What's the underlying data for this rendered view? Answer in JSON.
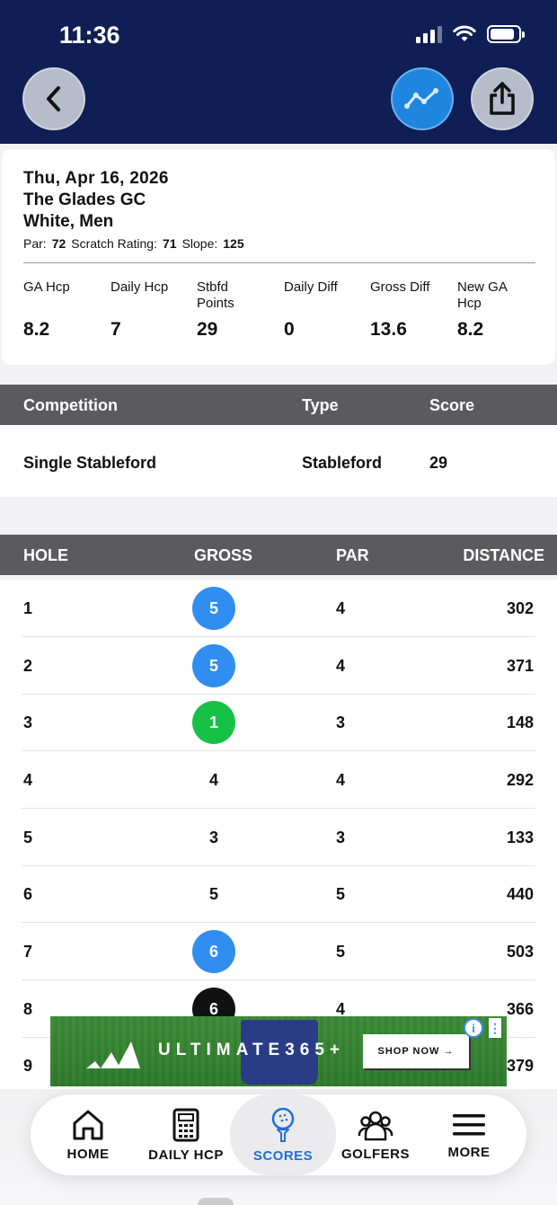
{
  "status_bar": {
    "time": "11:36"
  },
  "header": {
    "back_icon": "chevron-left-icon",
    "chart_icon": "trend-line-icon",
    "share_icon": "share-icon"
  },
  "round": {
    "date": "Thu, Apr 16, 2026",
    "course": "The Glades GC",
    "tee": "White, Men",
    "par_label": "Par:",
    "par": "72",
    "scratch_label": "Scratch Rating:",
    "scratch": "71",
    "slope_label": "Slope:",
    "slope": "125"
  },
  "stats": [
    {
      "label": "GA Hcp",
      "value": "8.2"
    },
    {
      "label": "Daily Hcp",
      "value": "7"
    },
    {
      "label": "Stbfd Points",
      "value": "29"
    },
    {
      "label": "Daily Diff",
      "value": "0"
    },
    {
      "label": "Gross Diff",
      "value": "13.6"
    },
    {
      "label": "New GA Hcp",
      "value": "8.2"
    }
  ],
  "competition": {
    "headers": {
      "competition": "Competition",
      "type": "Type",
      "score": "Score"
    },
    "row": {
      "competition": "Single Stableford",
      "type": "Stableford",
      "score": "29"
    }
  },
  "holes_table": {
    "headers": {
      "hole": "HOLE",
      "gross": "GROSS",
      "par": "PAR",
      "distance": "DISTANCE"
    },
    "rows": [
      {
        "hole": "1",
        "gross": "5",
        "par": "4",
        "distance": "302",
        "marker": "bogey"
      },
      {
        "hole": "2",
        "gross": "5",
        "par": "4",
        "distance": "371",
        "marker": "bogey"
      },
      {
        "hole": "3",
        "gross": "1",
        "par": "3",
        "distance": "148",
        "marker": "birdie"
      },
      {
        "hole": "4",
        "gross": "4",
        "par": "4",
        "distance": "292",
        "marker": "none"
      },
      {
        "hole": "5",
        "gross": "3",
        "par": "3",
        "distance": "133",
        "marker": "none"
      },
      {
        "hole": "6",
        "gross": "5",
        "par": "5",
        "distance": "440",
        "marker": "none"
      },
      {
        "hole": "7",
        "gross": "6",
        "par": "5",
        "distance": "503",
        "marker": "bogey"
      },
      {
        "hole": "8",
        "gross": "6",
        "par": "4",
        "distance": "366",
        "marker": "double"
      },
      {
        "hole": "9",
        "gross": "",
        "par": "",
        "distance": "379",
        "marker": "none"
      }
    ]
  },
  "ad": {
    "brand": "ULTIMATE365+",
    "cta": "SHOP NOW →",
    "info": "i",
    "close": "⋮"
  },
  "bottom_nav": [
    {
      "label": "HOME",
      "icon": "home-icon",
      "active": false
    },
    {
      "label": "DAILY HCP",
      "icon": "calculator-icon",
      "active": false
    },
    {
      "label": "SCORES",
      "icon": "golf-ball-tee-icon",
      "active": true
    },
    {
      "label": "GOLFERS",
      "icon": "people-icon",
      "active": false
    },
    {
      "label": "MORE",
      "icon": "menu-icon",
      "active": false
    }
  ],
  "colors": {
    "header": "#0f1f56",
    "accent": "#1f86e0",
    "bogey": "#2f8ef0",
    "birdie": "#17c146",
    "double": "#111111",
    "table_head": "#5b5b5d"
  }
}
